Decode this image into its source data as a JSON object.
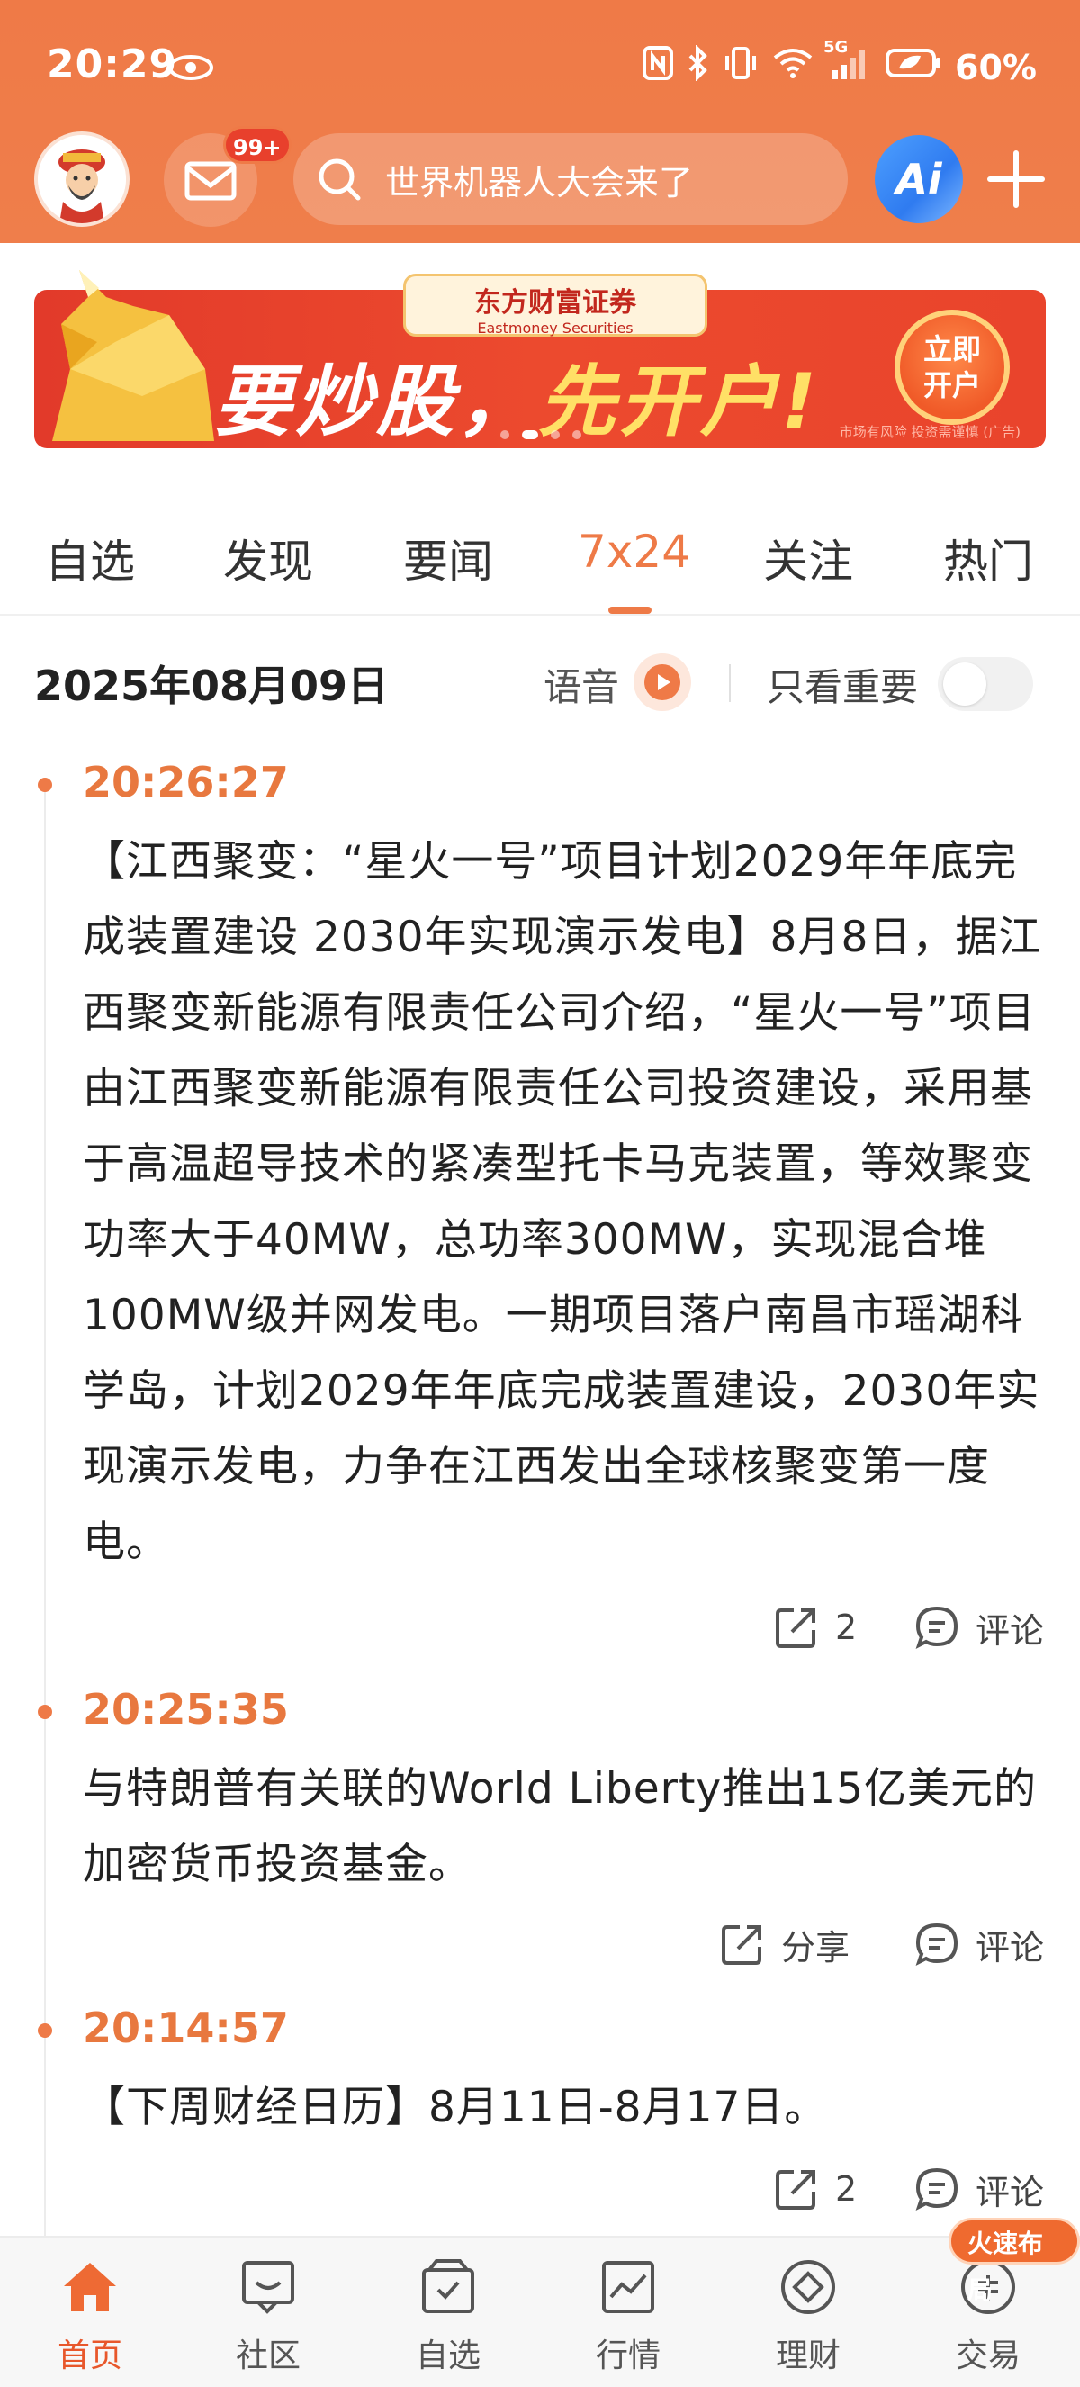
{
  "status_bar": {
    "time": "20:29",
    "network": "5G",
    "battery": "60%"
  },
  "header": {
    "mail_badge": "99+",
    "search_placeholder": "世界机器人大会来了",
    "ai_label": "Ai"
  },
  "banner": {
    "brand_cn": "东方财富证券",
    "brand_en": "Eastmoney Securities",
    "slogan_part1": "要炒股，",
    "slogan_part2": "先开户!",
    "open_button_line1": "立即",
    "open_button_line2": "开户",
    "risk_note": "市场有风险 投资需谨慎 (广告)"
  },
  "tabs": [
    {
      "label": "自选"
    },
    {
      "label": "发现"
    },
    {
      "label": "要闻"
    },
    {
      "label": "7x24"
    },
    {
      "label": "关注"
    },
    {
      "label": "热门"
    }
  ],
  "feed_header": {
    "date": "2025年08月09日",
    "voice_label": "语音",
    "important_only_label": "只看重要"
  },
  "feed": [
    {
      "time": "20:26:27",
      "content": "【江西聚变：“星火一号”项目计划2029年年底完成装置建设 2030年实现演示发电】8月8日，据江西聚变新能源有限责任公司介绍，“星火一号”项目由江西聚变新能源有限责任公司投资建设，采用基于高温超导技术的紧凑型托卡马克装置，等效聚变功率大于40MW，总功率300MW，实现混合堆100MW级并网发电。一期项目落户南昌市瑶湖科学岛，计划2029年年底完成装置建设，2030年实现演示发电，力争在江西发出全球核聚变第一度电。",
      "share_label": "2",
      "comment_label": "评论"
    },
    {
      "time": "20:25:35",
      "content": "与特朗普有关联的World Liberty推出15亿美元的加密货币投资基金。",
      "share_label": "分享",
      "comment_label": "评论"
    },
    {
      "time": "20:14:57",
      "content": "【下周财经日历】8月11日-8月17日。",
      "share_label": "2",
      "comment_label": "评论"
    }
  ],
  "bottom_nav": {
    "speed_tag": "火速布局",
    "items": [
      {
        "label": "首页",
        "icon": "home-icon"
      },
      {
        "label": "社区",
        "icon": "community-icon"
      },
      {
        "label": "自选",
        "icon": "watchlist-icon"
      },
      {
        "label": "行情",
        "icon": "market-icon"
      },
      {
        "label": "理财",
        "icon": "wealth-icon"
      },
      {
        "label": "交易",
        "icon": "trade-icon"
      }
    ]
  },
  "colors": {
    "brand_orange": "#ef7a47",
    "timestamp_orange": "#e8783f",
    "active_nav": "#e8572b"
  }
}
